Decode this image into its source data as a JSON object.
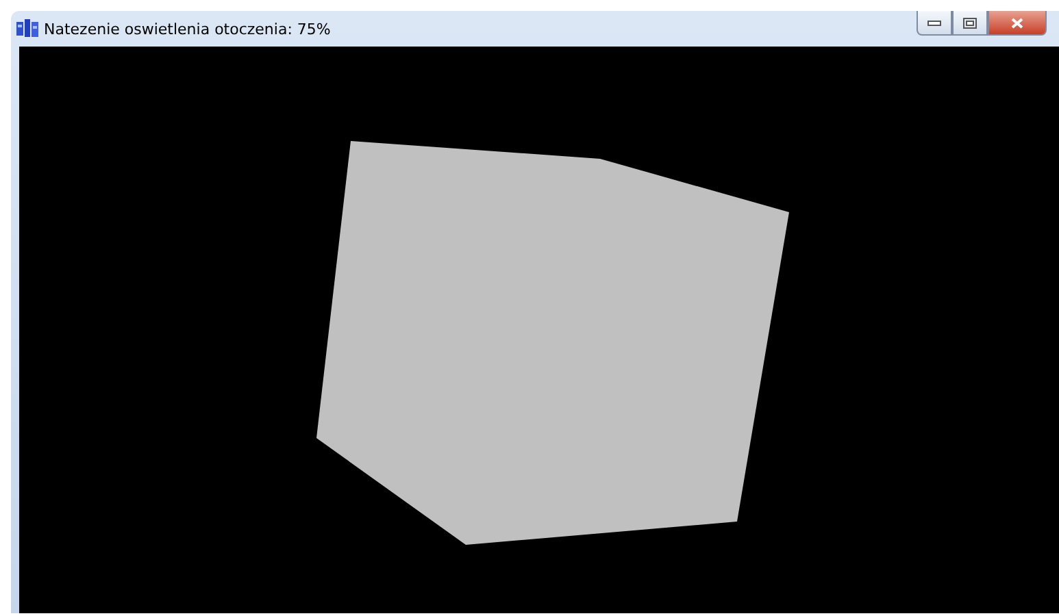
{
  "window": {
    "title": "Natezenie oswietlenia otoczenia: 75%"
  }
}
